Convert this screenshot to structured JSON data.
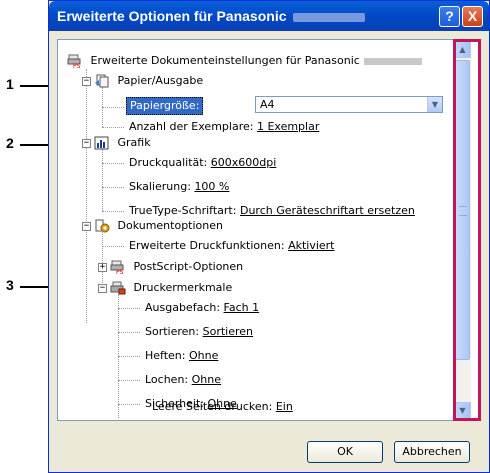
{
  "callouts": [
    "1",
    "2",
    "3"
  ],
  "window": {
    "title": "Erweiterte Optionen für Panasonic",
    "help_label": "?",
    "close_label": "X"
  },
  "tree": {
    "root_label": "Erweiterte Dokumenteinstellungen für Panasonic",
    "paper": {
      "label": "Papier/Ausgabe",
      "size_label": "Papiergröße:",
      "size_value": "A4",
      "copies_label": "Anzahl der Exemplare:",
      "copies_value": "1 Exemplar"
    },
    "graphics": {
      "label": "Grafik",
      "quality_label": "Druckqualität:",
      "quality_value": "600x600dpi",
      "scaling_label": "Skalierung:",
      "scaling_value": "100 %",
      "truetype_label": "TrueType-Schriftart:",
      "truetype_value": "Durch Geräteschriftart ersetzen"
    },
    "docopts": {
      "label": "Dokumentoptionen",
      "advanced_label": "Erweiterte Druckfunktionen:",
      "advanced_value": "Aktiviert",
      "postscript_label": "PostScript-Optionen",
      "features_label": "Druckermerkmale",
      "features": [
        {
          "label": "Ausgabefach:",
          "value": "Fach 1"
        },
        {
          "label": "Sortieren:",
          "value": "Sortieren"
        },
        {
          "label": "Heften:",
          "value": "Ohne"
        },
        {
          "label": "Lochen:",
          "value": "Ohne"
        },
        {
          "label": "Sicherheit:",
          "value": "Ohne"
        },
        {
          "label": "Leere Seiten drucken:",
          "value": "Ein"
        }
      ]
    }
  },
  "buttons": {
    "ok": "OK",
    "cancel": "Abbrechen"
  },
  "colors": {
    "title_bar": "#0a5fd9",
    "highlight_frame": "#c0175a",
    "selection": "#316ac5"
  }
}
